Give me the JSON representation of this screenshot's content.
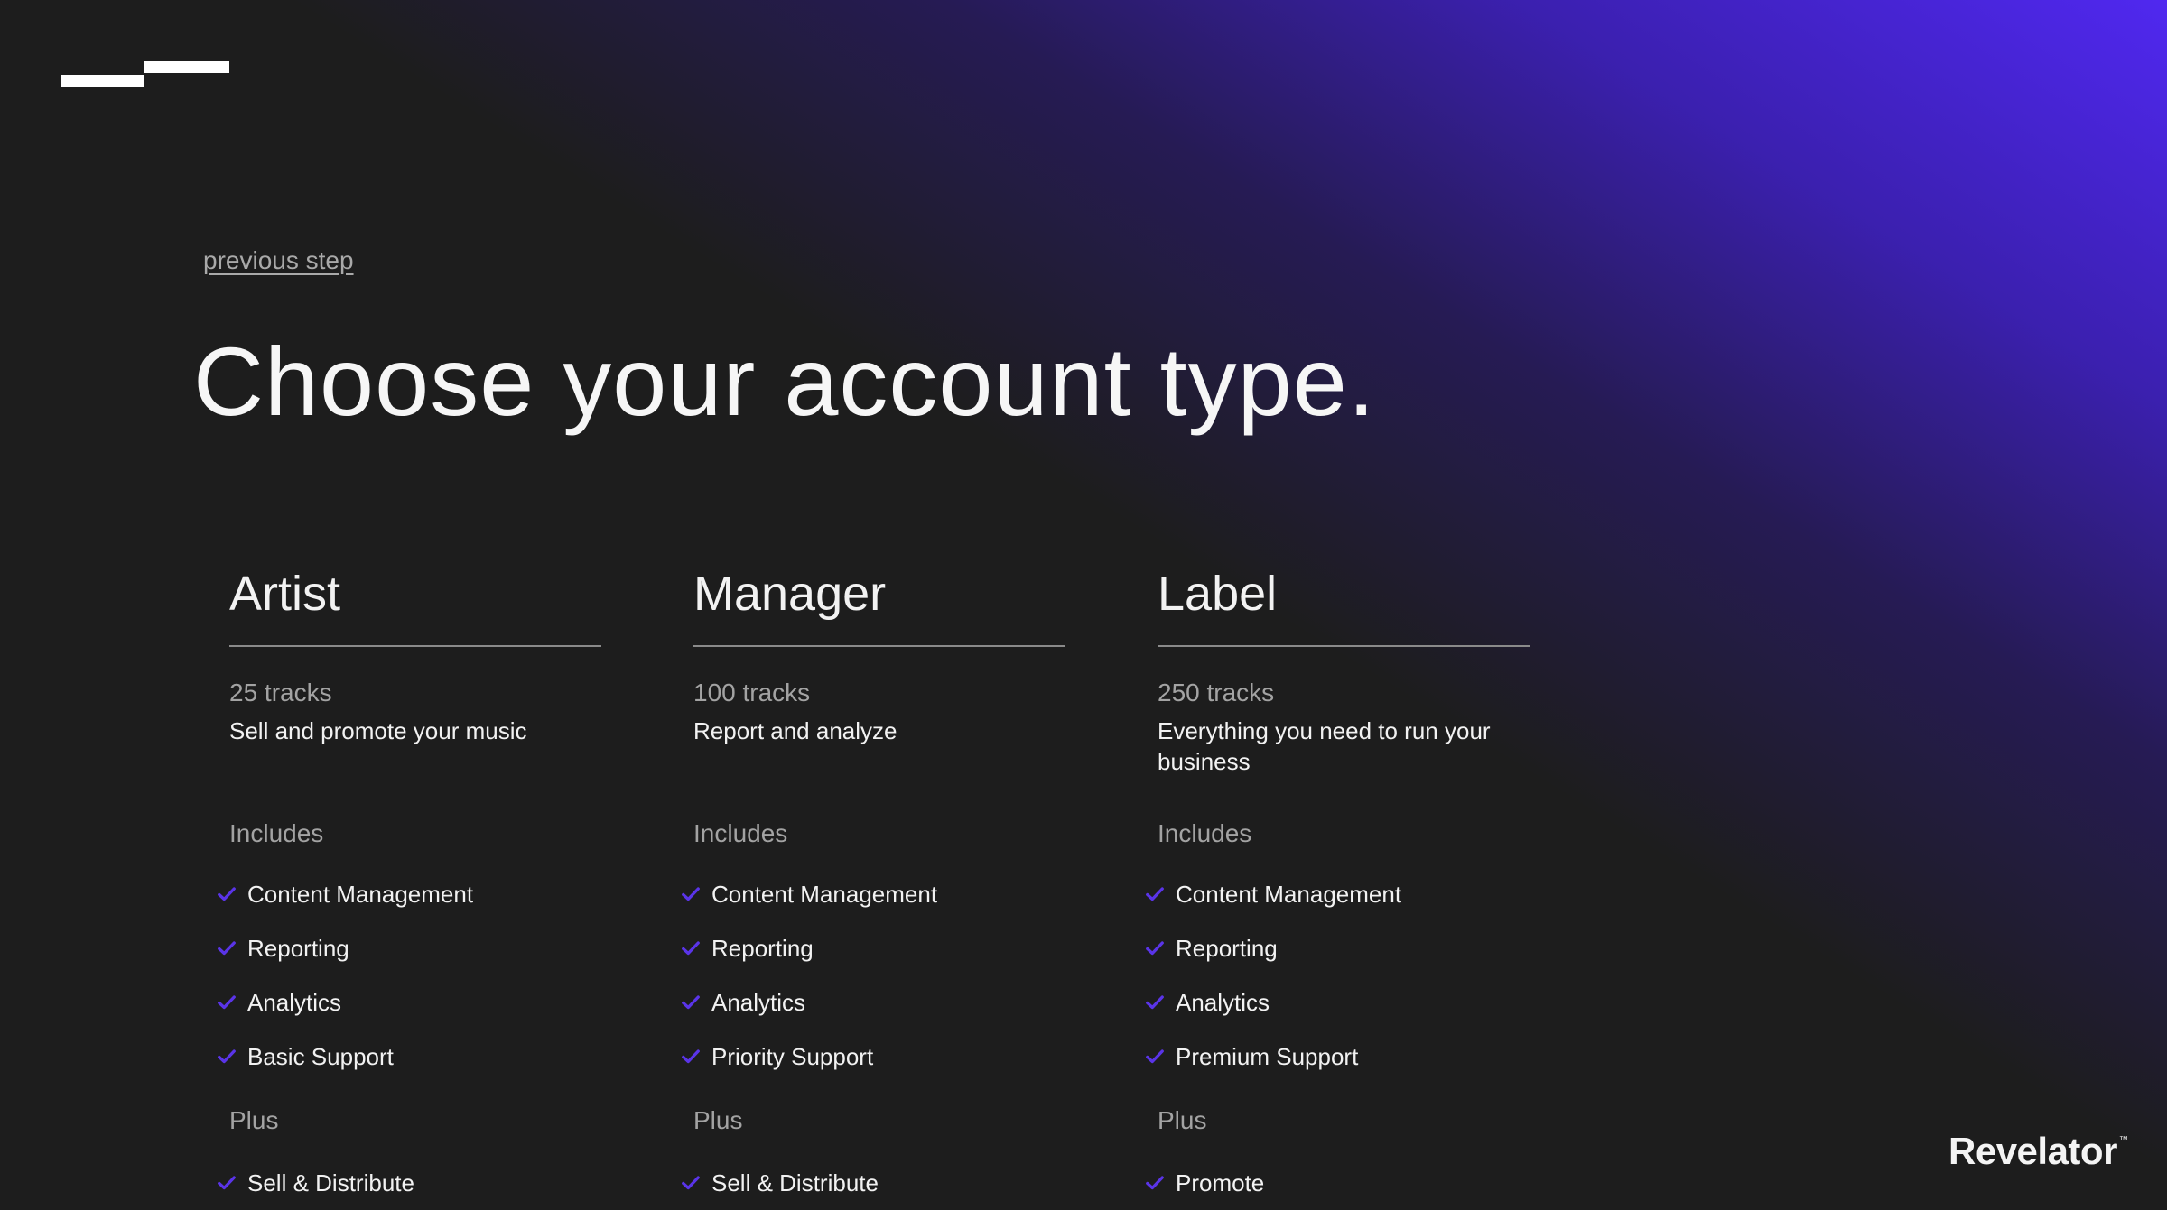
{
  "nav": {
    "previous_step": "previous step"
  },
  "header": {
    "title": "Choose your account type."
  },
  "plans": [
    {
      "name": "Artist",
      "tracks": "25 tracks",
      "description": "Sell and promote your music",
      "includes_label": "Includes",
      "includes": [
        "Content Management",
        "Reporting",
        "Analytics",
        "Basic Support"
      ],
      "plus_label": "Plus",
      "plus": [
        "Sell & Distribute"
      ]
    },
    {
      "name": "Manager",
      "tracks": "100 tracks",
      "description": "Report and analyze",
      "includes_label": "Includes",
      "includes": [
        "Content Management",
        "Reporting",
        "Analytics",
        "Priority Support"
      ],
      "plus_label": "Plus",
      "plus": [
        "Sell & Distribute"
      ]
    },
    {
      "name": "Label",
      "tracks": "250 tracks",
      "description": "Everything you need to run your business",
      "includes_label": "Includes",
      "includes": [
        "Content Management",
        "Reporting",
        "Analytics",
        "Premium Support"
      ],
      "plus_label": "Plus",
      "plus": [
        "Promote"
      ]
    }
  ],
  "brand": {
    "name": "Revelator",
    "trademark": "™"
  },
  "colors": {
    "background": "#1d1d1d",
    "accent": "#5a34e8",
    "gradient": "#4f2ae6"
  },
  "icons": {
    "logo": "steps-logo-icon",
    "feature": "check-icon"
  }
}
